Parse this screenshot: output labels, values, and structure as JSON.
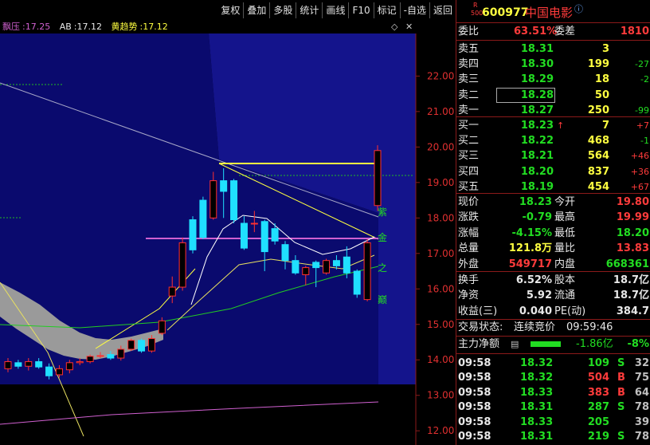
{
  "toolbar": {
    "items": [
      {
        "label": "复权"
      },
      {
        "label": "叠加"
      },
      {
        "label": "多股"
      },
      {
        "label": "统计"
      },
      {
        "label": "画线"
      },
      {
        "label": "F10"
      },
      {
        "label": "标记"
      },
      {
        "label": "-自选"
      },
      {
        "label": "返回"
      }
    ]
  },
  "indicators": {
    "piaoya_label": "飘压",
    "piaoya_value": "17.25",
    "ab_label": "AB",
    "ab_value": "17.12",
    "huang_label": "黄趋势",
    "huang_value": "17.12"
  },
  "chart": {
    "y_axis": {
      "min": 11.6,
      "max": 23.2,
      "ticks": [
        "22.00",
        "21.00",
        "20.00",
        "19.00",
        "18.00",
        "17.00",
        "16.00",
        "15.00",
        "14.00",
        "13.00",
        "12.00"
      ]
    },
    "side_labels": [
      "紫",
      "金",
      "之",
      "巅"
    ],
    "candles": [
      {
        "o": 13.75,
        "c": 13.95,
        "h": 14.05,
        "l": 13.65
      },
      {
        "o": 13.92,
        "c": 13.82,
        "h": 14.0,
        "l": 13.75
      },
      {
        "o": 13.82,
        "c": 13.95,
        "h": 14.05,
        "l": 13.7
      },
      {
        "o": 13.95,
        "c": 13.8,
        "h": 14.05,
        "l": 13.75
      },
      {
        "o": 13.8,
        "c": 13.55,
        "h": 13.9,
        "l": 13.45
      },
      {
        "o": 13.58,
        "c": 13.75,
        "h": 13.85,
        "l": 13.5
      },
      {
        "o": 13.72,
        "c": 13.92,
        "h": 14.0,
        "l": 13.62
      },
      {
        "o": 13.92,
        "c": 13.95,
        "h": 14.05,
        "l": 13.85
      },
      {
        "o": 13.95,
        "c": 14.1,
        "h": 14.15,
        "l": 13.9
      },
      {
        "o": 14.12,
        "c": 14.12,
        "h": 14.22,
        "l": 14.05
      },
      {
        "o": 14.15,
        "c": 14.05,
        "h": 14.25,
        "l": 14.0
      },
      {
        "o": 14.05,
        "c": 14.3,
        "h": 14.4,
        "l": 13.98
      },
      {
        "o": 14.3,
        "c": 14.55,
        "h": 14.6,
        "l": 14.25
      },
      {
        "o": 14.55,
        "c": 14.25,
        "h": 14.6,
        "l": 14.2
      },
      {
        "o": 14.25,
        "c": 14.6,
        "h": 14.7,
        "l": 14.2
      },
      {
        "o": 14.75,
        "c": 15.1,
        "h": 15.2,
        "l": 14.7
      },
      {
        "o": 15.8,
        "c": 16.05,
        "h": 16.35,
        "l": 15.6
      },
      {
        "o": 16.05,
        "c": 17.3,
        "h": 17.45,
        "l": 15.95
      },
      {
        "o": 17.95,
        "c": 17.1,
        "h": 18.05,
        "l": 17.0
      },
      {
        "o": 18.5,
        "c": 17.45,
        "h": 18.6,
        "l": 17.4
      },
      {
        "o": 18.0,
        "c": 19.05,
        "h": 19.3,
        "l": 17.95
      },
      {
        "o": 19.05,
        "c": 18.75,
        "h": 19.4,
        "l": 18.0
      },
      {
        "o": 19.05,
        "c": 17.95,
        "h": 19.1,
        "l": 17.85
      },
      {
        "o": 17.85,
        "c": 17.15,
        "h": 18.05,
        "l": 17.1
      },
      {
        "o": 17.85,
        "c": 17.85,
        "h": 18.2,
        "l": 17.6
      },
      {
        "o": 17.9,
        "c": 17.05,
        "h": 17.95,
        "l": 16.5
      },
      {
        "o": 17.7,
        "c": 17.35,
        "h": 17.85,
        "l": 17.25
      },
      {
        "o": 17.25,
        "c": 16.8,
        "h": 17.35,
        "l": 16.55
      },
      {
        "o": 16.8,
        "c": 16.45,
        "h": 16.95,
        "l": 16.4
      },
      {
        "o": 16.4,
        "c": 16.6,
        "h": 16.65,
        "l": 16.1
      },
      {
        "o": 16.75,
        "c": 16.6,
        "h": 16.8,
        "l": 16.05
      },
      {
        "o": 16.45,
        "c": 16.8,
        "h": 16.85,
        "l": 16.4
      },
      {
        "o": 16.8,
        "c": 16.65,
        "h": 16.95,
        "l": 16.55
      },
      {
        "o": 16.9,
        "c": 16.45,
        "h": 17.2,
        "l": 16.3
      },
      {
        "o": 16.5,
        "c": 15.85,
        "h": 16.55,
        "l": 15.75
      },
      {
        "o": 15.7,
        "c": 17.3,
        "h": 17.4,
        "l": 15.65
      },
      {
        "o": 18.35,
        "c": 19.9,
        "h": 20.05,
        "l": 18.2
      }
    ]
  },
  "quote": {
    "code": "600977",
    "name": "中国电影",
    "badge_r": "R",
    "badge_500": "500",
    "weibi_label": "委比",
    "weibi_value": "63.51%",
    "weicha_label": "委差",
    "weicha_value": "1810",
    "asks": [
      {
        "label": "卖五",
        "price": "18.31",
        "vol": "3",
        "chg": ""
      },
      {
        "label": "卖四",
        "price": "18.30",
        "vol": "199",
        "chg": "-27"
      },
      {
        "label": "卖三",
        "price": "18.29",
        "vol": "18",
        "chg": "-2"
      },
      {
        "label": "卖二",
        "price": "18.28",
        "vol": "50",
        "chg": ""
      },
      {
        "label": "卖一",
        "price": "18.27",
        "vol": "250",
        "chg": "-99"
      }
    ],
    "bids": [
      {
        "label": "买一",
        "price": "18.23",
        "vol": "7",
        "chg": "+7",
        "arrow": "↑"
      },
      {
        "label": "买二",
        "price": "18.22",
        "vol": "468",
        "chg": "-1",
        "arrow": ""
      },
      {
        "label": "买三",
        "price": "18.21",
        "vol": "564",
        "chg": "+46",
        "arrow": ""
      },
      {
        "label": "买四",
        "price": "18.20",
        "vol": "837",
        "chg": "+36",
        "arrow": ""
      },
      {
        "label": "买五",
        "price": "18.19",
        "vol": "454",
        "chg": "+67",
        "arrow": ""
      }
    ],
    "stats": [
      {
        "l1": "现价",
        "v1": "18.23",
        "l2": "今开",
        "v2": "19.80"
      },
      {
        "l1": "涨跌",
        "v1": "-0.79",
        "l2": "最高",
        "v2": "19.99"
      },
      {
        "l1": "涨幅",
        "v1": "-4.15%",
        "l2": "最低",
        "v2": "18.20"
      },
      {
        "l1": "总量",
        "v1": "121.8万",
        "l2": "量比",
        "v2": "13.83"
      },
      {
        "l1": "外盘",
        "v1": "549717",
        "l2": "内盘",
        "v2": "668361"
      }
    ],
    "stats2": [
      {
        "l1": "换手",
        "v1": "6.52%",
        "l2": "股本",
        "v2": "18.7亿"
      },
      {
        "l1": "净资",
        "v1": "5.92",
        "l2": "流通",
        "v2": "18.7亿"
      },
      {
        "l1": "收益(三)",
        "v1": "0.040",
        "l2": "PE(动)",
        "v2": "384.7"
      }
    ],
    "trade_status_label": "交易状态:",
    "trade_status_value": "连续竞价",
    "trade_status_time": "09:59:46",
    "flow_label": "主力净额",
    "flow_value": "-1.86亿",
    "flow_pct": "-8%",
    "ticks": [
      {
        "time": "09:58",
        "price": "18.32",
        "vol": "109",
        "side": "S",
        "n": "32"
      },
      {
        "time": "09:58",
        "price": "18.32",
        "vol": "504",
        "side": "B",
        "n": "75"
      },
      {
        "time": "09:58",
        "price": "18.33",
        "vol": "383",
        "side": "B",
        "n": "64"
      },
      {
        "time": "09:58",
        "price": "18.31",
        "vol": "287",
        "side": "S",
        "n": "78"
      },
      {
        "time": "09:58",
        "price": "18.33",
        "vol": "205",
        "side": "",
        "n": "39"
      },
      {
        "time": "09:58",
        "price": "18.31",
        "vol": "219",
        "side": "S",
        "n": "78"
      }
    ]
  }
}
